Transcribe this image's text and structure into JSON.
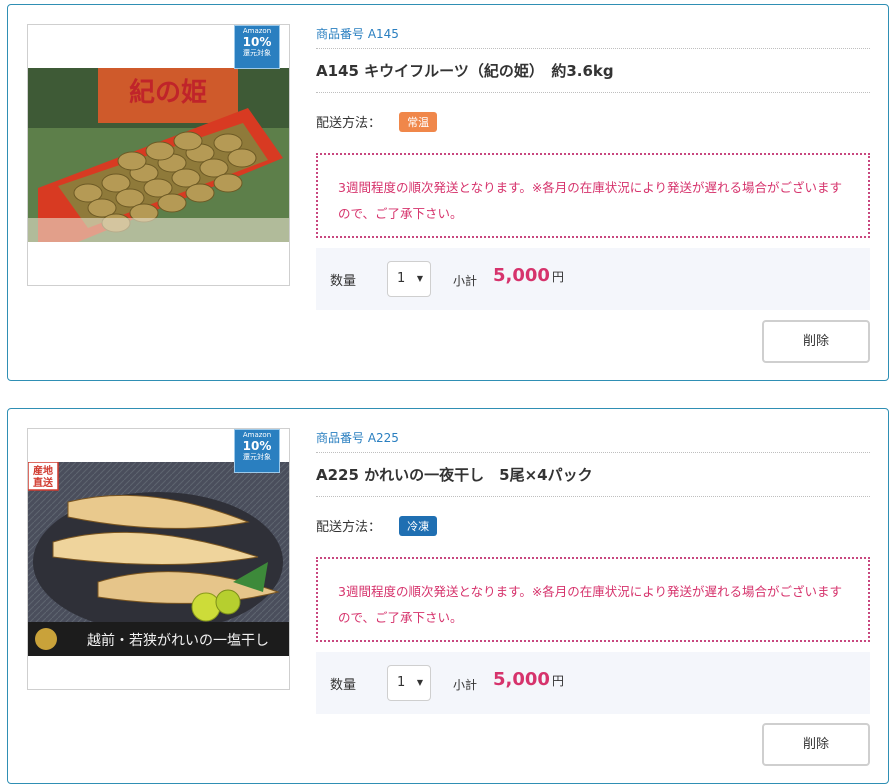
{
  "items": [
    {
      "product_no": "商品番号 A145",
      "name": "A145 キウイフルーツ（紀の姫）　約3.6kg",
      "shipping_label": "配送方法：",
      "shipping_tag": "常温",
      "shipping_tag_color": "#f0874a",
      "note": "3週間程度の順次発送となります。※各月の在庫状況により発送が遅れる場合がございますので、ご了承下さい。",
      "qty_label": "数量",
      "qty_value": "1",
      "subtotal_label": "小計",
      "subtotal_value": "5,000",
      "subtotal_unit": "円",
      "delete_label": "削除",
      "badge": {
        "line1": "Amazon",
        "line2": "10%",
        "line3": "還元対象"
      },
      "image_text": "紀の姫"
    },
    {
      "product_no": "商品番号 A225",
      "name": "A225 かれいの一夜干し　5尾×4パック",
      "shipping_label": "配送方法：",
      "shipping_tag": "冷凍",
      "shipping_tag_color": "#1f6fb2",
      "note": "3週間程度の順次発送となります。※各月の在庫状況により発送が遅れる場合がございますので、ご了承下さい。",
      "qty_label": "数量",
      "qty_value": "1",
      "subtotal_label": "小計",
      "subtotal_value": "5,000",
      "subtotal_unit": "円",
      "delete_label": "削除",
      "badge": {
        "line1": "Amazon",
        "line2": "10%",
        "line3": "還元対象"
      },
      "image_text": "越前・若狭がれいの一塩干し",
      "image_stamp": "産地直送"
    }
  ]
}
